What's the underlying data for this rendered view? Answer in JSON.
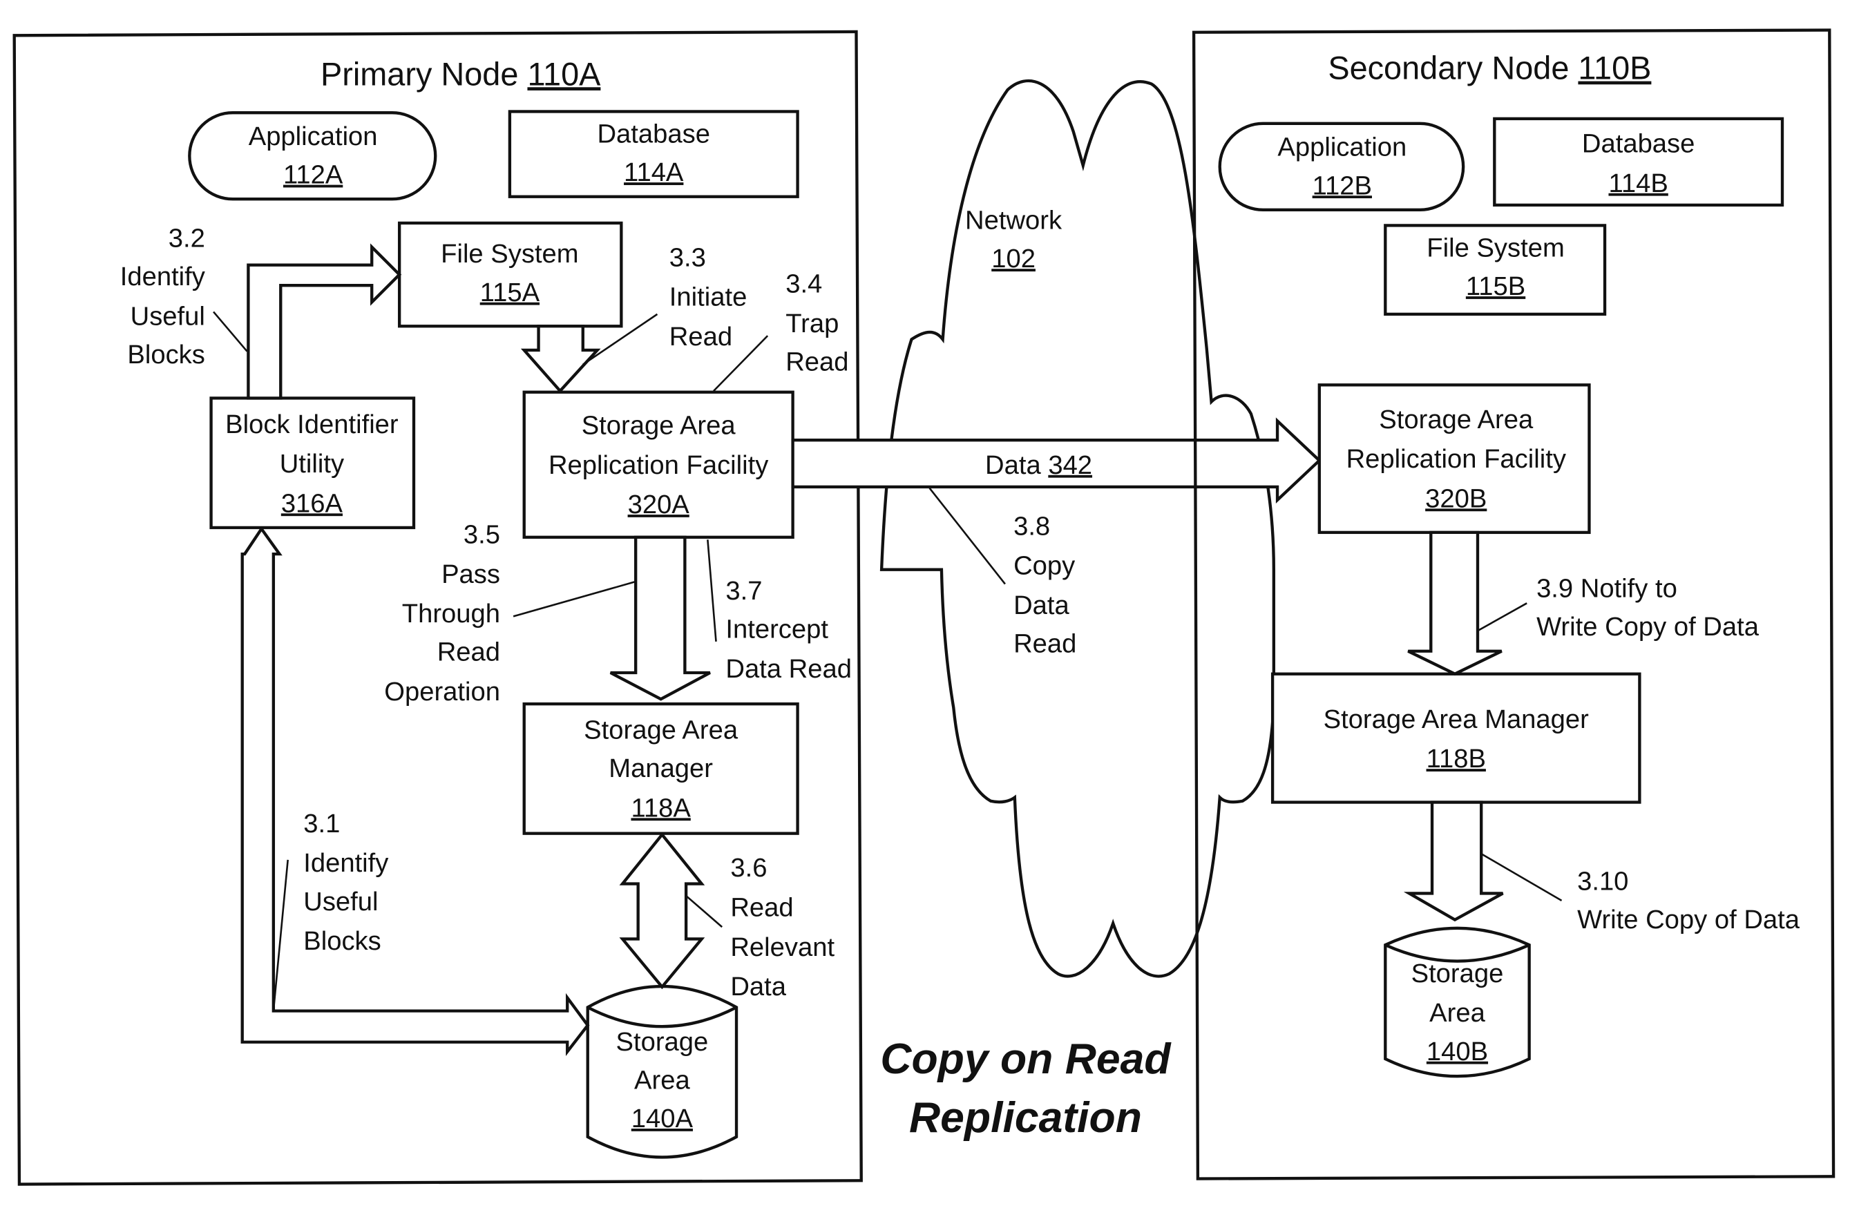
{
  "figure_title": [
    "Copy on Read",
    "Replication"
  ],
  "network": {
    "label": "Network",
    "ref": "102"
  },
  "data_flow": {
    "label": "Data",
    "ref": "342"
  },
  "primary_node": {
    "title": "Primary Node",
    "ref": "110A",
    "application": {
      "label": "Application",
      "ref": "112A"
    },
    "database": {
      "label": "Database",
      "ref": "114A"
    },
    "file_system": {
      "label": "File System",
      "ref": "115A"
    },
    "block_identifier": {
      "lines": [
        "Block Identifier",
        "Utility"
      ],
      "ref": "316A"
    },
    "replication_facility": {
      "lines": [
        "Storage Area",
        "Replication Facility"
      ],
      "ref": "320A"
    },
    "storage_manager": {
      "lines": [
        "Storage Area",
        "Manager"
      ],
      "ref": "118A"
    },
    "storage_area": {
      "lines": [
        "Storage",
        "Area"
      ],
      "ref": "140A"
    }
  },
  "secondary_node": {
    "title": "Secondary Node",
    "ref": "110B",
    "application": {
      "label": "Application",
      "ref": "112B"
    },
    "database": {
      "label": "Database",
      "ref": "114B"
    },
    "file_system": {
      "label": "File System",
      "ref": "115B"
    },
    "replication_facility": {
      "lines": [
        "Storage Area",
        "Replication Facility"
      ],
      "ref": "320B"
    },
    "storage_manager": {
      "lines": [
        "Storage Area Manager"
      ],
      "ref": "118B"
    },
    "storage_area": {
      "lines": [
        "Storage",
        "Area"
      ],
      "ref": "140B"
    }
  },
  "steps": {
    "s3_1": [
      "3.1",
      "Identify",
      "Useful",
      "Blocks"
    ],
    "s3_2": [
      "3.2",
      "Identify",
      "Useful",
      "Blocks"
    ],
    "s3_3": [
      "3.3",
      "Initiate",
      "Read"
    ],
    "s3_4": [
      "3.4",
      "Trap",
      "Read"
    ],
    "s3_5": [
      "3.5",
      "Pass",
      "Through",
      "Read",
      "Operation"
    ],
    "s3_6": [
      "3.6",
      "Read",
      "Relevant",
      "Data"
    ],
    "s3_7": [
      "3.7",
      "Intercept",
      "Data Read"
    ],
    "s3_8": [
      "3.8",
      "Copy",
      "Data",
      "Read"
    ],
    "s3_9": [
      "3.9 Notify to",
      "Write Copy of Data"
    ],
    "s3_10": [
      "3.10",
      "Write Copy of Data"
    ]
  }
}
